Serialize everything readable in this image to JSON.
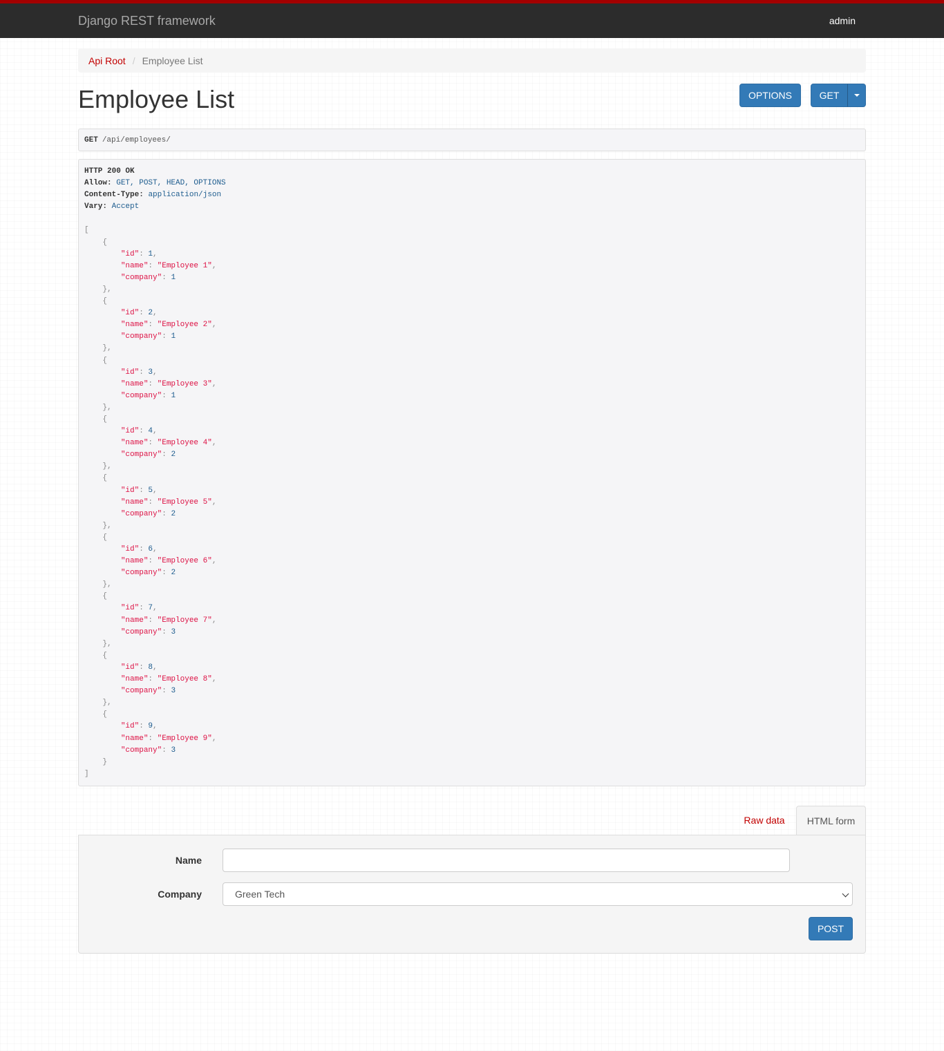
{
  "navbar": {
    "brand": "Django REST framework",
    "user": "admin"
  },
  "breadcrumb": {
    "root": "Api Root",
    "separator": "/",
    "current": "Employee List"
  },
  "page": {
    "title": "Employee List"
  },
  "actions": {
    "options_label": "OPTIONS",
    "get_label": "GET"
  },
  "request": {
    "method": "GET",
    "path": "/api/employees/"
  },
  "response": {
    "status": "HTTP 200 OK",
    "headers": [
      {
        "key": "Allow:",
        "value": "GET, POST, HEAD, OPTIONS"
      },
      {
        "key": "Content-Type:",
        "value": "application/json"
      },
      {
        "key": "Vary:",
        "value": "Accept"
      }
    ],
    "employees": [
      {
        "id": 1,
        "name": "Employee 1",
        "company": 1
      },
      {
        "id": 2,
        "name": "Employee 2",
        "company": 1
      },
      {
        "id": 3,
        "name": "Employee 3",
        "company": 1
      },
      {
        "id": 4,
        "name": "Employee 4",
        "company": 2
      },
      {
        "id": 5,
        "name": "Employee 5",
        "company": 2
      },
      {
        "id": 6,
        "name": "Employee 6",
        "company": 2
      },
      {
        "id": 7,
        "name": "Employee 7",
        "company": 3
      },
      {
        "id": 8,
        "name": "Employee 8",
        "company": 3
      },
      {
        "id": 9,
        "name": "Employee 9",
        "company": 3
      }
    ]
  },
  "tabs": {
    "raw": "Raw data",
    "html": "HTML form"
  },
  "form": {
    "name_label": "Name",
    "name_value": "",
    "company_label": "Company",
    "company_selected": "Green Tech",
    "post_label": "POST"
  },
  "colors": {
    "accent": "#337ab7",
    "brand_bar": "#a30000",
    "navbar": "#2c2c2c",
    "link": "#c20000"
  }
}
